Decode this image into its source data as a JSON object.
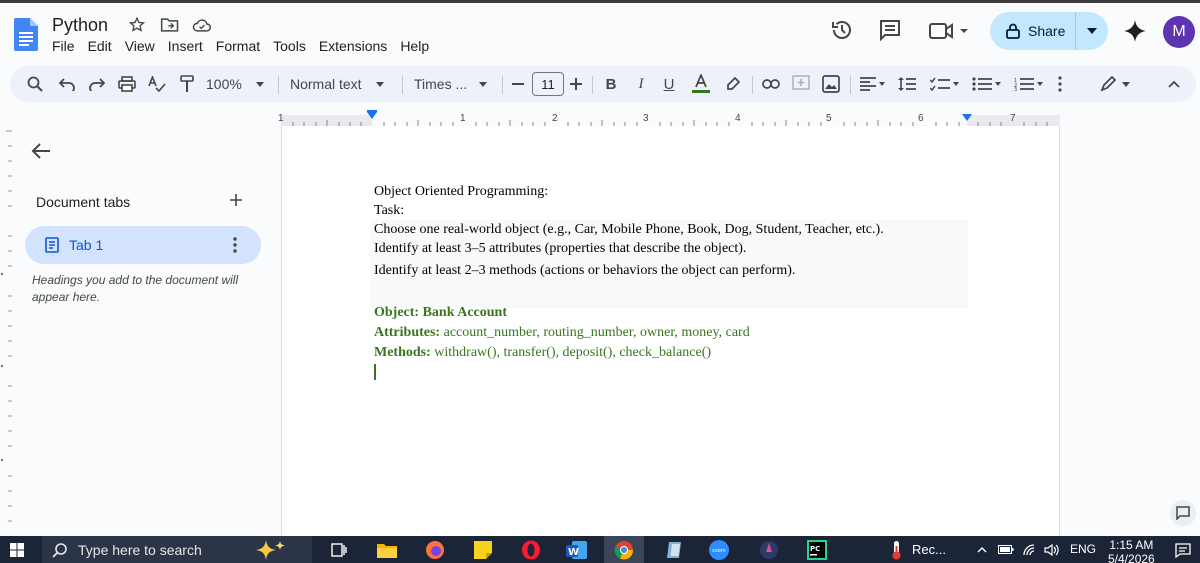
{
  "header": {
    "doc_title": "Python",
    "menu": [
      "File",
      "Edit",
      "View",
      "Insert",
      "Format",
      "Tools",
      "Extensions",
      "Help"
    ],
    "share_label": "Share",
    "avatar_letter": "M"
  },
  "toolbar": {
    "zoom": "100%",
    "style": "Normal text",
    "font": "Times ...",
    "font_size": "11"
  },
  "ruler": {
    "numbers": [
      "1",
      "1",
      "2",
      "3",
      "4",
      "5",
      "6",
      "7"
    ]
  },
  "sidebar": {
    "title": "Document tabs",
    "tab_label": "Tab 1",
    "hint": "Headings you add to the document will appear here."
  },
  "document": {
    "line1": "Object Oriented Programming:",
    "line2": "Task:",
    "line3": "Choose one real-world object (e.g., Car, Mobile Phone, Book, Dog, Student, Teacher, etc.).",
    "line4": "Identify at least 3–5 attributes (properties that describe the object).",
    "line5": "Identify at least 2–3 methods (actions or behaviors the object can perform).",
    "object_line": "Object: Bank Account",
    "attributes_label": "Attributes:",
    "attributes_value": " account_number, routing_number, owner, money, card",
    "methods_label": "Methods:",
    "methods_value": " withdraw(), transfer(), deposit(), check_balance()"
  },
  "taskbar": {
    "search_placeholder": "Type here to search",
    "rec_label": "Rec...",
    "lang": "ENG",
    "time": "1:15 AM",
    "date": "5/4/2026"
  },
  "colors": {
    "accent": "#0b57d0",
    "share_bg": "#c2e7ff",
    "doc_green": "#38761d",
    "taskbar": "#1b2537"
  }
}
